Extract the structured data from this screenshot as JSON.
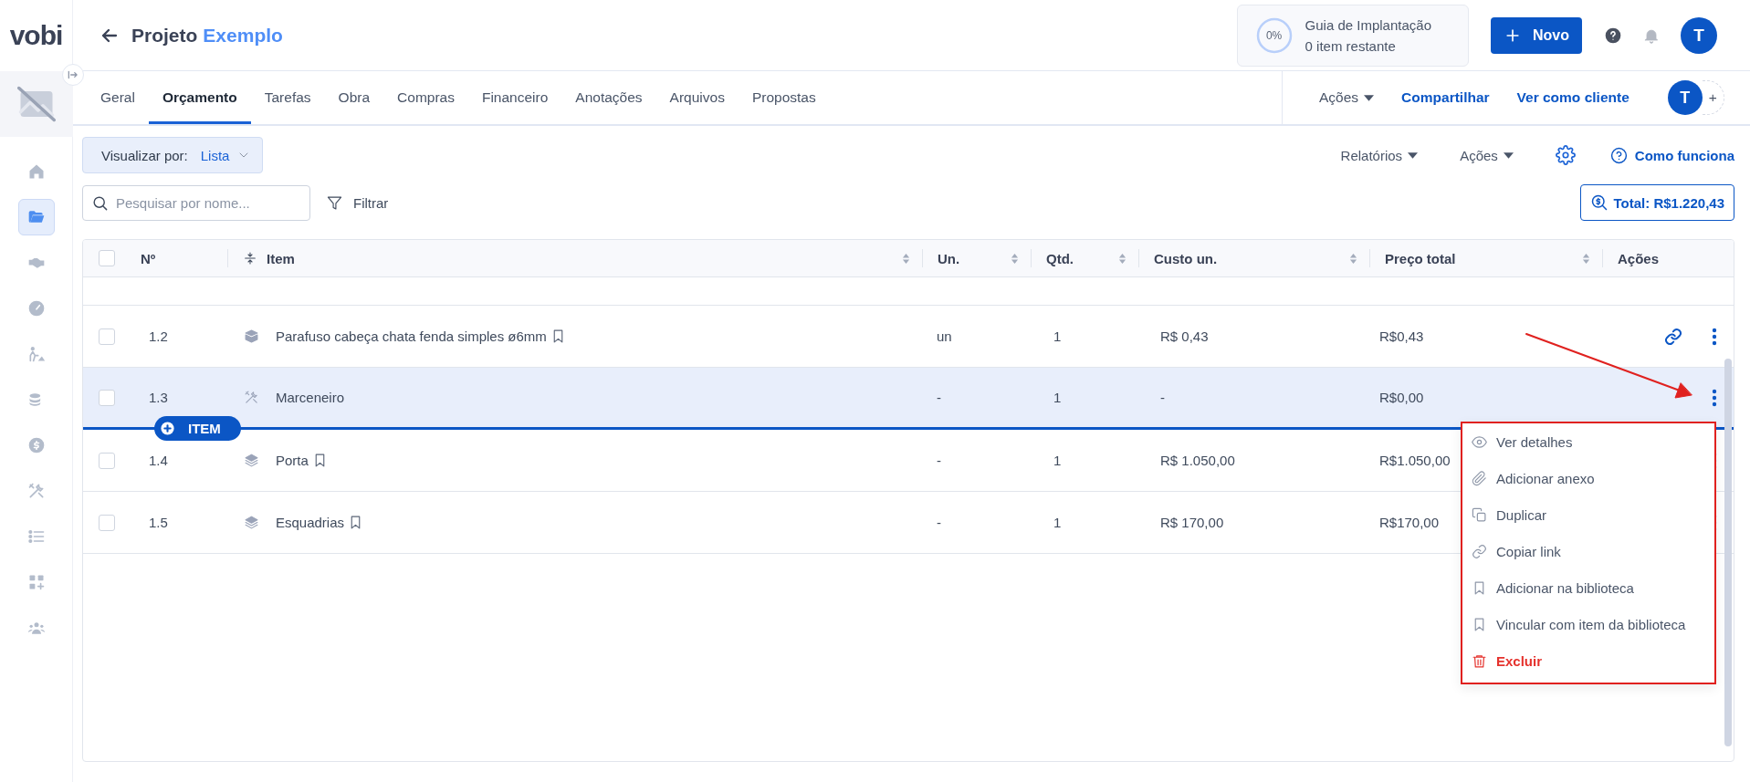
{
  "app": {
    "logo": "vobi"
  },
  "sidebar": {
    "items": [
      {
        "selected": false
      },
      {
        "selected": true
      },
      {
        "selected": false
      },
      {
        "selected": false
      },
      {
        "selected": false
      },
      {
        "selected": false
      },
      {
        "selected": false
      },
      {
        "selected": false
      },
      {
        "selected": false
      },
      {
        "selected": false
      },
      {
        "selected": false
      }
    ]
  },
  "header": {
    "title_prefix": "Projeto",
    "title_name": "Exemplo",
    "guide": {
      "percent": "0%",
      "level": 0,
      "title": "Guia de Implantação",
      "subtitle": "0 item restante"
    },
    "new_button": "Novo",
    "avatar": "T"
  },
  "tabs": [
    {
      "label": "Geral",
      "selected": false
    },
    {
      "label": "Orçamento",
      "selected": true
    },
    {
      "label": "Tarefas",
      "selected": false
    },
    {
      "label": "Obra",
      "selected": false
    },
    {
      "label": "Compras",
      "selected": false
    },
    {
      "label": "Financeiro",
      "selected": false
    },
    {
      "label": "Anotações",
      "selected": false
    },
    {
      "label": "Arquivos",
      "selected": false
    },
    {
      "label": "Propostas",
      "selected": false
    }
  ],
  "tab_actions": {
    "actions": "Ações",
    "share": "Compartilhar",
    "view_as_client": "Ver como cliente",
    "avatar": "T",
    "add": "+"
  },
  "toolbar": {
    "view_label": "Visualizar por:",
    "view_value": "Lista",
    "reports": "Relatórios",
    "actions": "Ações",
    "help": "Como funciona",
    "search_placeholder": "Pesquisar por nome...",
    "filter": "Filtrar",
    "total": "Total: R$1.220,43"
  },
  "table": {
    "all_checked": false,
    "insert_label": "ITEM",
    "columns": [
      {
        "label": "Nº",
        "sortable": false
      },
      {
        "label": "Item",
        "sortable": true
      },
      {
        "label": "Un.",
        "sortable": true
      },
      {
        "label": "Qtd.",
        "sortable": true
      },
      {
        "label": "Custo un.",
        "sortable": true
      },
      {
        "label": "Preço total",
        "sortable": true
      },
      {
        "label": "Ações",
        "sortable": false
      }
    ],
    "rows": [
      {
        "number": "1.2",
        "kind": "material",
        "name": "Parafuso cabeça chata fenda simples ø6mm",
        "bookmarked": true,
        "unit": "un",
        "qty": "1",
        "unit_cost": "R$ 0,43",
        "total": "R$0,43",
        "linked": true,
        "checked": false,
        "highlighted": false,
        "insert_below": false
      },
      {
        "number": "1.3",
        "kind": "service",
        "name": "Marceneiro",
        "bookmarked": false,
        "unit": "-",
        "qty": "1",
        "unit_cost": "-",
        "total": "R$0,00",
        "linked": false,
        "checked": false,
        "highlighted": true,
        "insert_below": true
      },
      {
        "number": "1.4",
        "kind": "composition",
        "name": "Porta",
        "bookmarked": true,
        "unit": "-",
        "qty": "1",
        "unit_cost": "R$ 1.050,00",
        "total": "R$1.050,00",
        "linked": false,
        "checked": false,
        "highlighted": false,
        "insert_below": false
      },
      {
        "number": "1.5",
        "kind": "composition",
        "name": "Esquadrias",
        "bookmarked": true,
        "unit": "-",
        "qty": "1",
        "unit_cost": "R$ 170,00",
        "total": "R$170,00",
        "linked": false,
        "checked": false,
        "highlighted": false,
        "insert_below": false
      }
    ]
  },
  "context_menu": {
    "items": [
      {
        "label": "Ver detalhes",
        "kind": "normal"
      },
      {
        "label": "Adicionar anexo",
        "kind": "normal"
      },
      {
        "label": "Duplicar",
        "kind": "normal"
      },
      {
        "label": "Copiar link",
        "kind": "normal"
      },
      {
        "label": "Adicionar na biblioteca",
        "kind": "normal"
      },
      {
        "label": "Vincular com item da biblioteca",
        "kind": "normal"
      },
      {
        "label": "Excluir",
        "kind": "danger"
      }
    ]
  }
}
